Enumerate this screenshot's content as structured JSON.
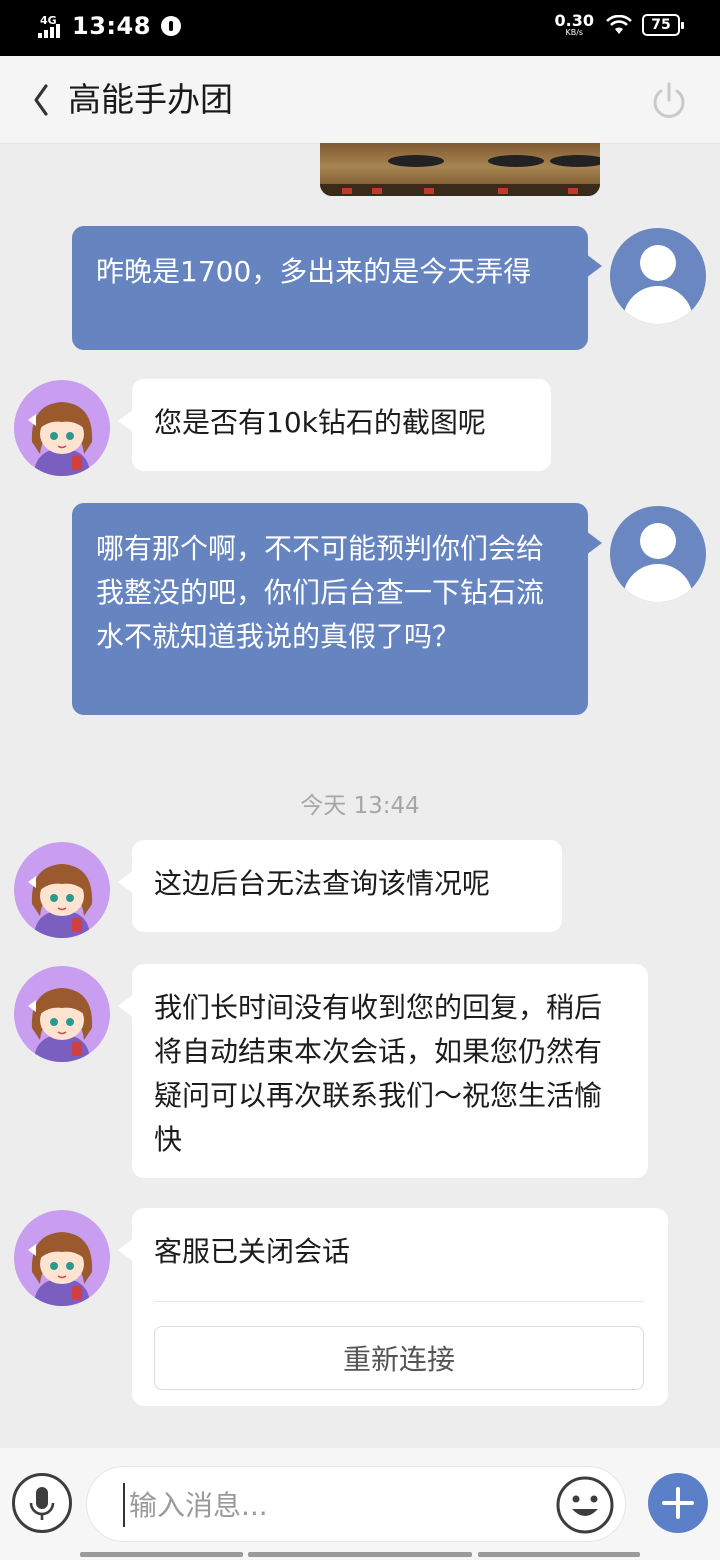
{
  "status_bar": {
    "network": "4G",
    "time": "13:48",
    "speed_value": "0.30",
    "speed_unit": "KB/s",
    "battery": "75"
  },
  "header": {
    "title": "高能手办团"
  },
  "messages": [
    {
      "from": "user",
      "text": "昨晚是1700，多出来的是今天弄得"
    },
    {
      "from": "agent",
      "text": "您是否有10k钻石的截图呢"
    },
    {
      "from": "user",
      "text": "哪有那个啊，不不可能预判你们会给我整没的吧，你们后台查一下钻石流水不就知道我说的真假了吗？"
    },
    {
      "from": "agent",
      "text": "这边后台无法查询该情况呢"
    },
    {
      "from": "agent",
      "text": "我们长时间没有收到您的回复，稍后将自动结束本次会话，如果您仍然有疑问可以再次联系我们～祝您生活愉快"
    }
  ],
  "timestamp": "今天 13:44",
  "closed_card": {
    "text": "客服已关闭会话",
    "reconnect_label": "重新连接"
  },
  "input_bar": {
    "placeholder": "输入消息..."
  }
}
